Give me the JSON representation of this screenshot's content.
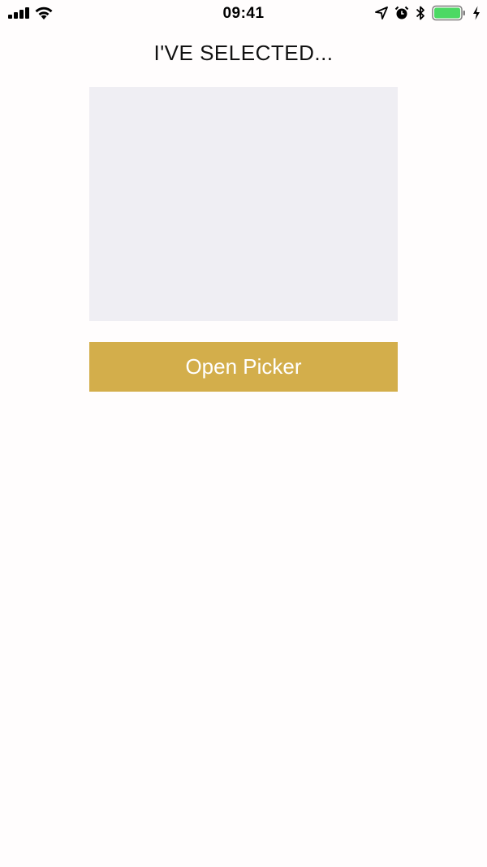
{
  "status_bar": {
    "time": "09:41",
    "icons": [
      "cellular-signal-icon",
      "wifi-icon",
      "location-arrow-icon",
      "alarm-icon",
      "bluetooth-icon",
      "battery-icon",
      "charging-bolt-icon"
    ],
    "battery_level": 1.0,
    "battery_color": "#4cd964"
  },
  "main": {
    "title": "I'VE SELECTED...",
    "selection_box_color": "#efeef3",
    "open_button_label": "Open Picker",
    "open_button_color": "#d3ae4b"
  }
}
